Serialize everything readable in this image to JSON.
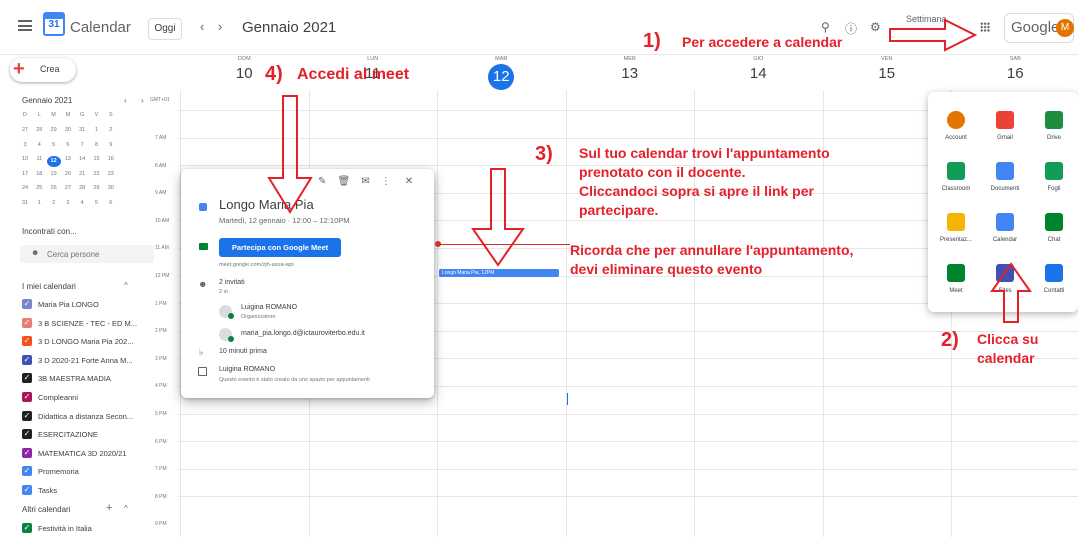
{
  "header": {
    "app_title": "Calendar",
    "logo_number": "31",
    "today_button": "Oggi",
    "prev": "‹",
    "next": "›",
    "month_title": "Gennaio 2021",
    "view_selector": "Settimana",
    "google_text": "Google",
    "avatar_letter": "M"
  },
  "sidebar": {
    "create_label": "Crea",
    "mini_month_title": "Gennaio 2021",
    "mini_weekdays": [
      "D",
      "L",
      "M",
      "M",
      "G",
      "V",
      "S"
    ],
    "mini_weeks": [
      [
        "27",
        "28",
        "29",
        "30",
        "31",
        "1",
        "2"
      ],
      [
        "3",
        "4",
        "5",
        "6",
        "7",
        "8",
        "9"
      ],
      [
        "10",
        "11",
        "12",
        "13",
        "14",
        "15",
        "16"
      ],
      [
        "17",
        "18",
        "19",
        "20",
        "21",
        "22",
        "23"
      ],
      [
        "24",
        "25",
        "26",
        "27",
        "28",
        "29",
        "30"
      ],
      [
        "31",
        "1",
        "2",
        "3",
        "4",
        "5",
        "6"
      ]
    ],
    "meet_title": "Incontrati con...",
    "search_people": "Cerca persone",
    "my_calendars_title": "I miei calendari",
    "my_calendars": [
      {
        "label": "Maria Pia LONGO",
        "color": "#7986cb"
      },
      {
        "label": "3 B SCIENZE - TEC - ED M...",
        "color": "#e67c73"
      },
      {
        "label": "3 D LONGO Maria Pia 202...",
        "color": "#f4511e"
      },
      {
        "label": "3 D 2020-21 Forte Anna M...",
        "color": "#3f51b5"
      },
      {
        "label": "3B MAESTRA MADIA",
        "color": "#202124"
      },
      {
        "label": "Compleanni",
        "color": "#ad1457"
      },
      {
        "label": "Didattica a distanza Secon...",
        "color": "#202124"
      },
      {
        "label": "ESERCITAZIONE",
        "color": "#202124"
      },
      {
        "label": "MATEMATICA 3D 2020/21",
        "color": "#8e24aa"
      },
      {
        "label": "Promemoria",
        "color": "#4285f4"
      },
      {
        "label": "Tasks",
        "color": "#4285f4"
      }
    ],
    "other_calendars_title": "Altri calendari",
    "other_calendars": [
      {
        "label": "Festività in Italia",
        "color": "#0b8043"
      }
    ]
  },
  "grid": {
    "timezone": "GMT+01",
    "days": [
      {
        "name": "DOM",
        "num": "10"
      },
      {
        "name": "LUN",
        "num": "11"
      },
      {
        "name": "MAR",
        "num": "12"
      },
      {
        "name": "MER",
        "num": "13"
      },
      {
        "name": "GIO",
        "num": "14"
      },
      {
        "name": "VEN",
        "num": "15"
      },
      {
        "name": "SAB",
        "num": "16"
      }
    ],
    "hours": [
      "7 AM",
      "8 AM",
      "9 AM",
      "10 AM",
      "11 AM",
      "12 PM",
      "1 PM",
      "2 PM",
      "3 PM",
      "4 PM",
      "5 PM",
      "6 PM",
      "7 PM",
      "8 PM",
      "9 PM"
    ],
    "event_label": "Longo Maria Pia, 12PM"
  },
  "popup": {
    "title": "Longo Maria Pia",
    "date": "Martedì, 12 gennaio · 12:00 – 12:10PM",
    "meet_button": "Partecipa con Google Meet",
    "meet_link": "meet.google.com/zjh-axua-wpi",
    "guests_count": "2 invitati",
    "guests_yes": "2 sì",
    "organizer_name": "Luigina ROMANO",
    "organizer_role": "Organizzatore",
    "guest_email": "maria_pia.longo.d@ictauroviterbo.edu.it",
    "reminder": "10 minuti prima",
    "calendar_owner": "Luigina ROMANO",
    "calendar_note": "Questo evento è stato creato da uno spazio per appuntamenti"
  },
  "apps": [
    {
      "label": "Account",
      "color": "#e37400"
    },
    {
      "label": "Gmail",
      "color": "#ea4335"
    },
    {
      "label": "Drive",
      "color": "#1e8e3e"
    },
    {
      "label": "Classroom",
      "color": "#0f9d58"
    },
    {
      "label": "Documenti",
      "color": "#4285f4"
    },
    {
      "label": "Fogli",
      "color": "#0f9d58"
    },
    {
      "label": "Presentaz...",
      "color": "#f4b400"
    },
    {
      "label": "Calendar",
      "color": "#4285f4"
    },
    {
      "label": "Chat",
      "color": "#00832d"
    },
    {
      "label": "Meet",
      "color": "#00832d"
    },
    {
      "label": "Sites",
      "color": "#3f51b5"
    },
    {
      "label": "Contatti",
      "color": "#1a73e8"
    }
  ],
  "annotations": {
    "n1": "1)",
    "t1": "Per accedere a calendar",
    "n2": "2)",
    "t2a": "Clicca su",
    "t2b": "calendar",
    "n3": "3)",
    "t3a": "Sul tuo calendar trovi l'appuntamento",
    "t3b": "prenotato con il docente.",
    "t3c": "Cliccandoci sopra si apre il link per",
    "t3d": "partecipare.",
    "t3e": "Ricorda che per annullare l'appuntamento,",
    "t3f": "devi eliminare questo evento",
    "n4": "4)",
    "t4": "Accedi al meet"
  }
}
